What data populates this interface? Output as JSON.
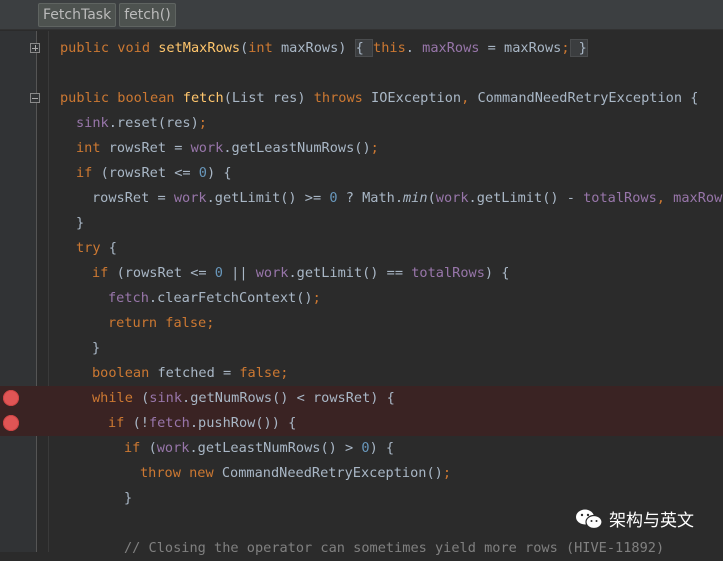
{
  "breadcrumbs": [
    "FetchTask",
    "fetch()"
  ],
  "watermark": "架构与英文",
  "colors": {
    "background": "#2b2b2b",
    "keyword": "#cc7832",
    "method": "#ffc66d",
    "field": "#9876aa",
    "number": "#6897bb",
    "breakpoint": "#e05555"
  },
  "code_lines": [
    {
      "fold": "plus",
      "indent": 60,
      "tokens": [
        [
          "kw",
          "public "
        ],
        [
          "kw",
          "void "
        ],
        [
          "fn",
          "setMaxRows"
        ],
        [
          "",
          "("
        ],
        [
          "kw",
          "int "
        ],
        [
          "",
          "maxRows) "
        ],
        [
          "box",
          "{ "
        ],
        [
          "kw",
          "this"
        ],
        [
          "",
          ". "
        ],
        [
          "fld",
          "maxRows"
        ],
        [
          "",
          " = maxRows"
        ],
        [
          "kw",
          ";"
        ],
        [
          "box",
          " }"
        ]
      ]
    },
    {
      "indent": 60,
      "tokens": []
    },
    {
      "fold": "minus",
      "indent": 60,
      "tokens": [
        [
          "kw",
          "public "
        ],
        [
          "kw",
          "boolean "
        ],
        [
          "fn",
          "fetch"
        ],
        [
          "",
          "(List res) "
        ],
        [
          "kw",
          "throws "
        ],
        [
          "",
          "IOException"
        ],
        [
          "kw",
          ", "
        ],
        [
          "",
          "CommandNeedRetryException {"
        ]
      ]
    },
    {
      "indent": 76,
      "tokens": [
        [
          "fld",
          "sink"
        ],
        [
          "",
          ".reset(res)"
        ],
        [
          "kw",
          ";"
        ]
      ]
    },
    {
      "indent": 76,
      "tokens": [
        [
          "kw",
          "int "
        ],
        [
          "",
          "rowsRet = "
        ],
        [
          "fld",
          "work"
        ],
        [
          "",
          ".getLeastNumRows()"
        ],
        [
          "kw",
          ";"
        ]
      ]
    },
    {
      "indent": 76,
      "tokens": [
        [
          "kw",
          "if "
        ],
        [
          "",
          "(rowsRet <= "
        ],
        [
          "num",
          "0"
        ],
        [
          "",
          ") {"
        ]
      ]
    },
    {
      "indent": 92,
      "tokens": [
        [
          "",
          "rowsRet = "
        ],
        [
          "fld",
          "work"
        ],
        [
          "",
          ".getLimit() >= "
        ],
        [
          "num",
          "0"
        ],
        [
          "",
          " ? Math."
        ],
        [
          "it",
          "min"
        ],
        [
          "",
          "("
        ],
        [
          "fld",
          "work"
        ],
        [
          "",
          ".getLimit() - "
        ],
        [
          "fld",
          "totalRows"
        ],
        [
          "kw",
          ", "
        ],
        [
          "fld",
          "maxRows"
        ],
        [
          "",
          ")"
        ]
      ]
    },
    {
      "indent": 76,
      "tokens": [
        [
          "",
          "}"
        ]
      ]
    },
    {
      "indent": 76,
      "tokens": [
        [
          "kw",
          "try "
        ],
        [
          "",
          "{"
        ]
      ]
    },
    {
      "indent": 92,
      "tokens": [
        [
          "kw",
          "if "
        ],
        [
          "",
          "(rowsRet <= "
        ],
        [
          "num",
          "0"
        ],
        [
          "",
          " || "
        ],
        [
          "fld",
          "work"
        ],
        [
          "",
          ".getLimit() == "
        ],
        [
          "fld",
          "totalRows"
        ],
        [
          "",
          ") {"
        ]
      ]
    },
    {
      "indent": 108,
      "tokens": [
        [
          "fld",
          "fetch"
        ],
        [
          "",
          ".clearFetchContext()"
        ],
        [
          "kw",
          ";"
        ]
      ]
    },
    {
      "indent": 108,
      "tokens": [
        [
          "kw",
          "return "
        ],
        [
          "kw",
          "false"
        ],
        [
          "kw",
          ";"
        ]
      ]
    },
    {
      "indent": 92,
      "tokens": [
        [
          "",
          "}"
        ]
      ]
    },
    {
      "indent": 92,
      "tokens": [
        [
          "kw",
          "boolean "
        ],
        [
          "",
          "fetched = "
        ],
        [
          "kw",
          "false"
        ],
        [
          "kw",
          ";"
        ]
      ]
    },
    {
      "breakpoint": true,
      "indent": 92,
      "tokens": [
        [
          "kw",
          "while "
        ],
        [
          "",
          "("
        ],
        [
          "fld",
          "sink"
        ],
        [
          "",
          ".getNumRows() < rowsRet) {"
        ]
      ]
    },
    {
      "breakpoint": true,
      "indent": 108,
      "tokens": [
        [
          "kw",
          "if "
        ],
        [
          "",
          "(!"
        ],
        [
          "fld",
          "fetch"
        ],
        [
          "",
          ".pushRow()) {"
        ]
      ]
    },
    {
      "indent": 124,
      "tokens": [
        [
          "kw",
          "if "
        ],
        [
          "",
          "("
        ],
        [
          "fld",
          "work"
        ],
        [
          "",
          ".getLeastNumRows() > "
        ],
        [
          "num",
          "0"
        ],
        [
          "",
          ") {"
        ]
      ]
    },
    {
      "indent": 140,
      "tokens": [
        [
          "kw",
          "throw "
        ],
        [
          "kw",
          "new "
        ],
        [
          "",
          "CommandNeedRetryException()"
        ],
        [
          "kw",
          ";"
        ]
      ]
    },
    {
      "indent": 124,
      "tokens": [
        [
          "",
          "}"
        ]
      ]
    },
    {
      "indent": 124,
      "tokens": []
    },
    {
      "indent": 124,
      "tokens": [
        [
          "cmt",
          "// Closing the operator can sometimes yield more rows (HIVE-11892)"
        ]
      ]
    }
  ]
}
